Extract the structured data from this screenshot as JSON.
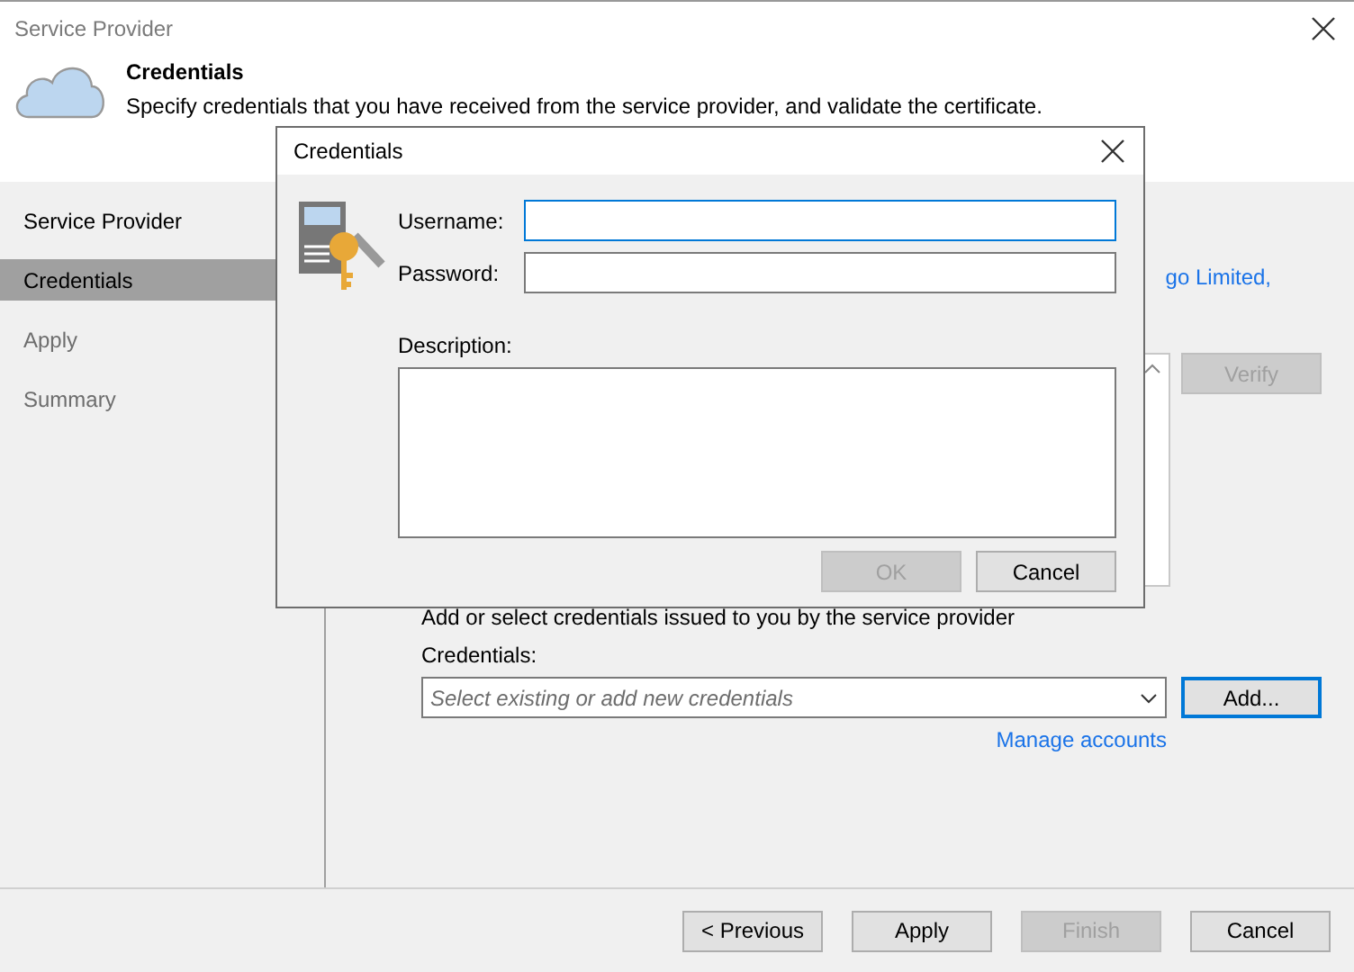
{
  "window": {
    "title": "Service Provider"
  },
  "header": {
    "title": "Credentials",
    "subtitle": "Specify credentials that you have received from the service provider, and validate the certificate."
  },
  "steps": [
    {
      "label": "Service Provider",
      "selected": false,
      "disabled": false
    },
    {
      "label": "Credentials",
      "selected": true,
      "disabled": false
    },
    {
      "label": "Apply",
      "selected": false,
      "disabled": true
    },
    {
      "label": "Summary",
      "selected": false,
      "disabled": true
    }
  ],
  "content": {
    "link": "go Limited,",
    "verify_button": {
      "label": "Verify",
      "disabled": true
    },
    "instruction": "Add or select credentials issued to you by the service provider",
    "credentials_label": "Credentials:",
    "credentials_placeholder": "Select existing or add new credentials",
    "add_button": "Add...",
    "manage_link": "Manage accounts"
  },
  "footer_buttons": [
    {
      "label": "< Previous",
      "disabled": false
    },
    {
      "label": "Apply",
      "disabled": false
    },
    {
      "label": "Finish",
      "disabled": true
    },
    {
      "label": "Cancel",
      "disabled": false
    }
  ],
  "dialog": {
    "title": "Credentials",
    "username_label": "Username:",
    "password_label": "Password:",
    "description_label": "Description:",
    "buttons": [
      {
        "label": "OK",
        "disabled": true
      },
      {
        "label": "Cancel",
        "disabled": false
      }
    ]
  }
}
